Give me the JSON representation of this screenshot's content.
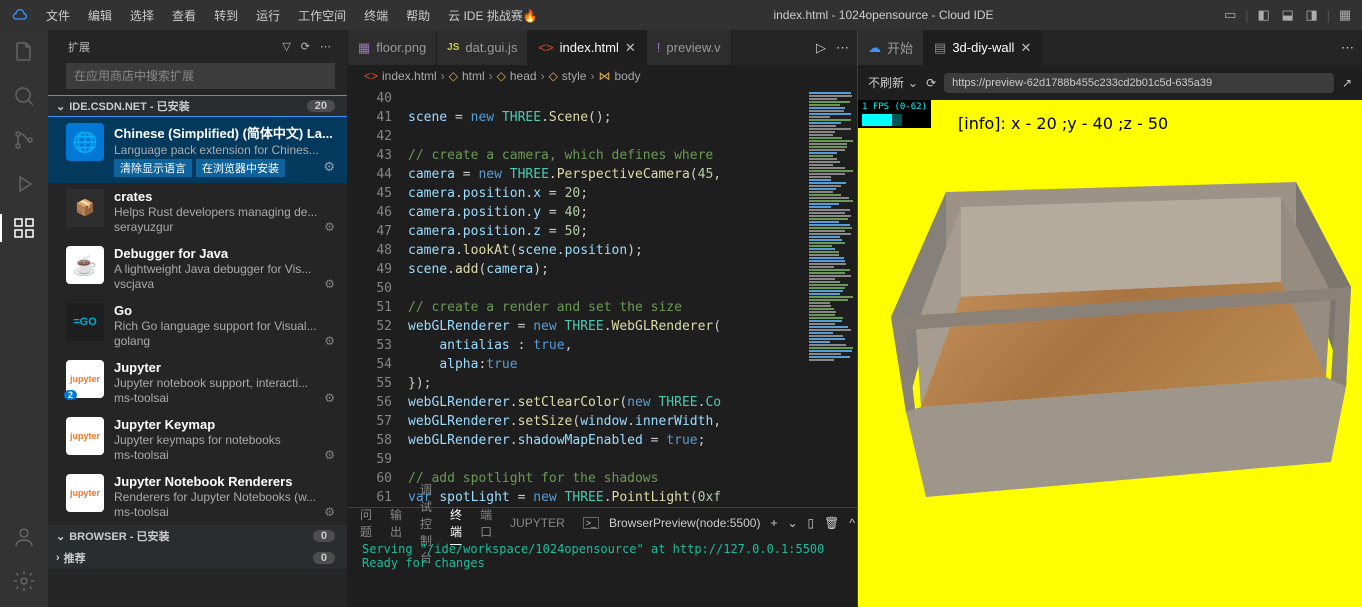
{
  "title": "index.html - 1024opensource - Cloud IDE",
  "menu": [
    "文件",
    "编辑",
    "选择",
    "查看",
    "转到",
    "运行",
    "工作空间",
    "终端",
    "帮助",
    "云 IDE 挑战赛"
  ],
  "sidebar": {
    "title": "扩展",
    "placeholder": "在应用商店中搜索扩展",
    "s1": {
      "label": "IDE.CSDN.NET - 已安装",
      "count": "20"
    },
    "s2": {
      "label": "BROWSER - 已安装",
      "count": "0"
    },
    "s3": {
      "label": "推荐",
      "count": "0"
    },
    "ext": [
      {
        "name": "Chinese (Simplified) (简体中文) La...",
        "desc": "Language pack extension for Chines...",
        "tag1": "清除显示语言",
        "tag2": "在浏览器中安装"
      },
      {
        "name": "crates",
        "desc": "Helps Rust developers managing de...",
        "author": "serayuzgur"
      },
      {
        "name": "Debugger for Java",
        "desc": "A lightweight Java debugger for Vis...",
        "author": "vscjava"
      },
      {
        "name": "Go",
        "desc": "Rich Go language support for Visual...",
        "author": "golang"
      },
      {
        "name": "Jupyter",
        "desc": "Jupyter notebook support, interacti...",
        "author": "ms-toolsai",
        "badge": "2"
      },
      {
        "name": "Jupyter Keymap",
        "desc": "Jupyter keymaps for notebooks",
        "author": "ms-toolsai"
      },
      {
        "name": "Jupyter Notebook Renderers",
        "desc": "Renderers for Jupyter Notebooks (w...",
        "author": "ms-toolsai"
      }
    ]
  },
  "tabs": {
    "items": [
      "floor.png",
      "dat.gui.js",
      "index.html",
      "preview.v"
    ],
    "start": "开始",
    "wall": "3d-diy-wall"
  },
  "breadcrumb": [
    "index.html",
    "html",
    "head",
    "style",
    "body"
  ],
  "terminal": {
    "tabs": [
      "问题",
      "输出",
      "调试控制台",
      "终端",
      "端口",
      "JUPYTER"
    ],
    "right": "BrowserPreview(node:5500)",
    "line1": "Serving \"/ide/workspace/1024opensource\" at http://127.0.0.1:5500",
    "line2": "Ready for changes"
  },
  "preview": {
    "refresh": "不刷新",
    "url": "https://preview-62d1788b455c233cd2b01c5d-635a39",
    "fps": "1 FPS (0-62)",
    "info": "[info]: x - 20 ;y - 40 ;z - 50"
  },
  "code": {
    "lines": [
      "40",
      "41",
      "42",
      "43",
      "44",
      "45",
      "46",
      "47",
      "48",
      "49",
      "50",
      "51",
      "52",
      "53",
      "54",
      "55",
      "56",
      "57",
      "58",
      "59",
      "60",
      "61"
    ]
  }
}
